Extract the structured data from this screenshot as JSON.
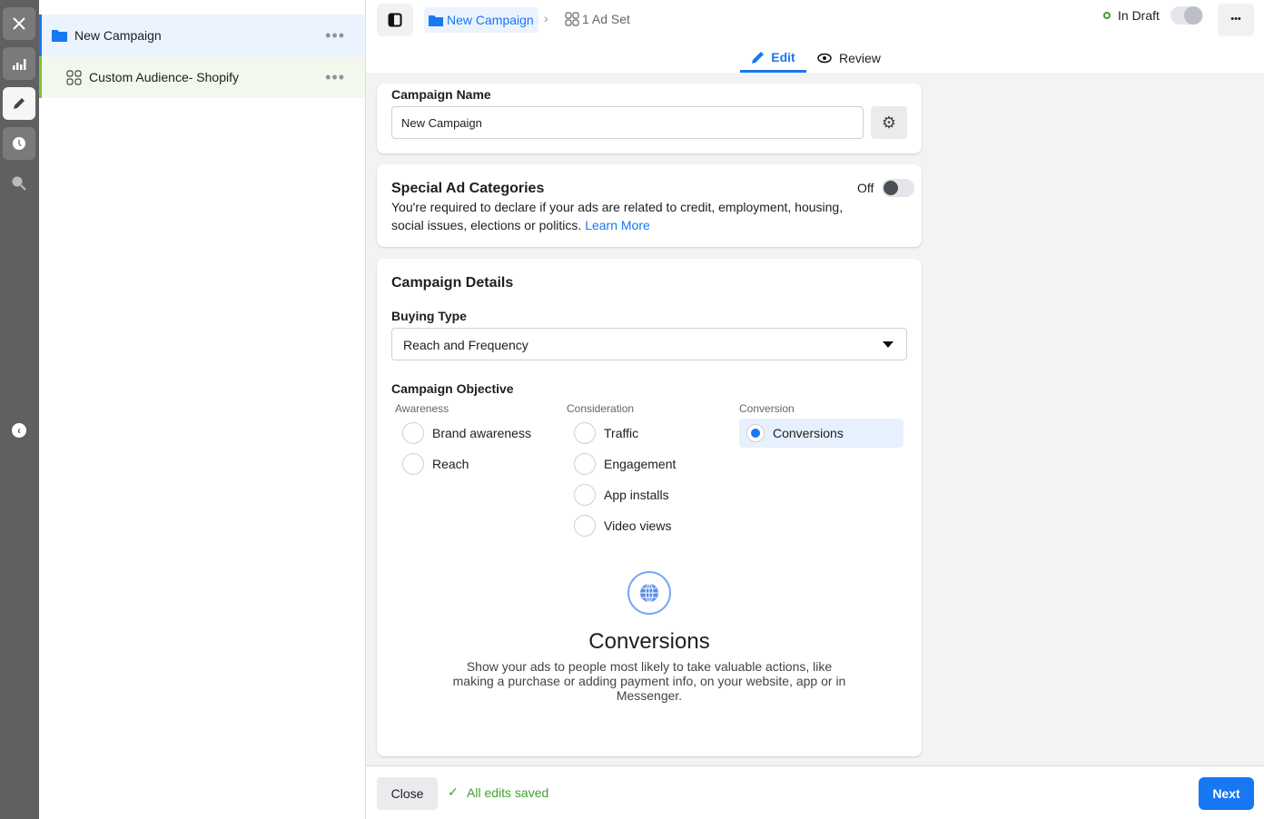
{
  "rail": {
    "items": [
      "close-icon",
      "chart-icon",
      "pencil-icon",
      "clock-icon",
      "search-insights-icon"
    ]
  },
  "sidebar": {
    "campaign": "New Campaign",
    "adset": "Custom Audience- Shopify",
    "more": "•••"
  },
  "header": {
    "breadcrumb_campaign": "New Campaign",
    "breadcrumb_adset": "1 Ad Set",
    "status": "In Draft",
    "more": "•••",
    "tabs": [
      {
        "label": "Edit",
        "active": true
      },
      {
        "label": "Review",
        "active": false
      }
    ]
  },
  "campaign_name": {
    "label": "Campaign Name",
    "value": "New Campaign"
  },
  "special": {
    "title": "Special Ad Categories",
    "desc": "You're required to declare if your ads are related to credit, employment, housing, social issues, elections or politics.",
    "link": "Learn More",
    "toggle_label": "Off",
    "toggle_on": false
  },
  "details": {
    "title": "Campaign Details",
    "buying_type_label": "Buying Type",
    "buying_type": "Reach and Frequency",
    "objective_label": "Campaign Objective",
    "columns": [
      {
        "heading": "Awareness",
        "options": [
          "Brand awareness",
          "Reach"
        ]
      },
      {
        "heading": "Consideration",
        "options": [
          "Traffic",
          "Engagement",
          "App installs",
          "Video views"
        ]
      },
      {
        "heading": "Conversion",
        "options": [
          "Conversions"
        ]
      }
    ],
    "selected": "Conversions",
    "info_title": "Conversions",
    "info_desc": "Show your ads to people most likely to take valuable actions, like making a purchase or adding payment info, on your website, app or in Messenger."
  },
  "footer": {
    "close": "Close",
    "saved": "All edits saved",
    "next": "Next"
  },
  "colors": {
    "accent": "#1877f2",
    "saved": "#42a02a",
    "rail": "#606060"
  }
}
